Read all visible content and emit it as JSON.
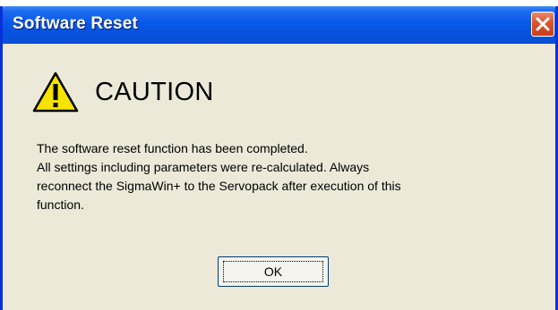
{
  "window": {
    "title": "Software Reset",
    "close_icon": "close-icon",
    "accent_color": "#0a58e8",
    "close_color": "#d9542c"
  },
  "dialog": {
    "icon": "warning-icon",
    "heading": "CAUTION",
    "message_lines": [
      "The software reset function has been completed.",
      "All settings including parameters were re-calculated. Always",
      "reconnect the SigmaWin+ to the Servopack after execution of this",
      "function."
    ],
    "ok_label": "OK"
  }
}
